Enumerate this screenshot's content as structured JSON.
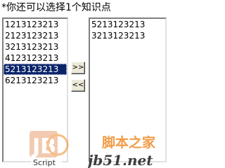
{
  "hint": {
    "text": "*你还可以选择1个知识点"
  },
  "left_list": {
    "options": [
      {
        "label": "1213123213",
        "selected": false
      },
      {
        "label": "2123123213",
        "selected": false
      },
      {
        "label": "3213123213",
        "selected": false
      },
      {
        "label": "4123123213",
        "selected": false
      },
      {
        "label": "5213123213",
        "selected": true
      },
      {
        "label": "6213123213",
        "selected": false
      }
    ]
  },
  "right_list": {
    "options": [
      {
        "label": "5213123213",
        "selected": false
      },
      {
        "label": "3213123213",
        "selected": false
      }
    ]
  },
  "buttons": {
    "add_label": ">>",
    "remove_label": "<<"
  },
  "watermark": {
    "logo_text": "Script",
    "site_cn": "脚本之家",
    "site_url": "jb51.net"
  },
  "colors": {
    "selection": "#0a246a",
    "watermark_orange": "#f08a24"
  }
}
